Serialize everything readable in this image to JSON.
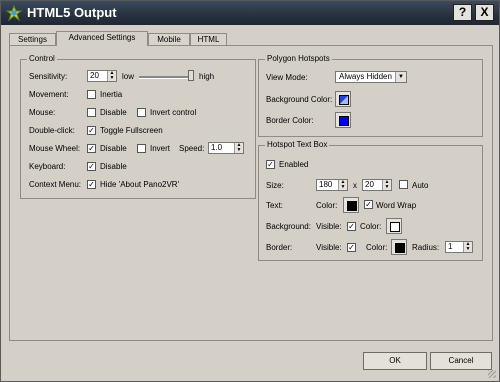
{
  "window": {
    "title": "HTML5 Output",
    "help_label": "?",
    "close_label": "X"
  },
  "tabs": [
    {
      "label": "Settings",
      "active": false
    },
    {
      "label": "Advanced Settings",
      "active": true
    },
    {
      "label": "Mobile",
      "active": false
    },
    {
      "label": "HTML",
      "active": false
    }
  ],
  "control": {
    "title": "Control",
    "sensitivity": {
      "label": "Sensitivity:",
      "value": "20",
      "low": "low",
      "high": "high",
      "slider_level": 1.0
    },
    "movement": {
      "label": "Movement:",
      "inertia_label": "Inertia",
      "inertia_checked": false
    },
    "mouse": {
      "label": "Mouse:",
      "disable_label": "Disable",
      "disable_checked": false,
      "invert_label": "Invert control",
      "invert_checked": false
    },
    "doubleclick": {
      "label": "Double-click:",
      "fullscreen_label": "Toggle Fullscreen",
      "fullscreen_checked": true
    },
    "wheel": {
      "label": "Mouse Wheel:",
      "disable_label": "Disable",
      "disable_checked": true,
      "invert_label": "Invert",
      "invert_checked": false,
      "speed_label": "Speed:",
      "speed_value": "1.0"
    },
    "keyboard": {
      "label": "Keyboard:",
      "disable_label": "Disable",
      "disable_checked": true
    },
    "context": {
      "label": "Context Menu:",
      "hide_label": "Hide 'About Pano2VR'",
      "hide_checked": true
    }
  },
  "polygon": {
    "title": "Polygon Hotspots",
    "view_mode_label": "View Mode:",
    "view_mode_value": "Always Hidden",
    "bg_label": "Background Color:",
    "bg_color": "#2244dd",
    "border_label": "Border Color:",
    "border_color": "#0000ee"
  },
  "textbox": {
    "title": "Hotspot Text Box",
    "enabled_label": "Enabled",
    "enabled_checked": true,
    "size_label": "Size:",
    "width": "180",
    "x_label": "x",
    "height": "20",
    "auto_label": "Auto",
    "auto_checked": false,
    "text_label": "Text:",
    "text_color_label": "Color:",
    "text_color": "#000000",
    "wordwrap_label": "Word Wrap",
    "wordwrap_checked": true,
    "background_label": "Background:",
    "bg_visible_label": "Visible:",
    "bg_visible_checked": true,
    "bg_color_label": "Color:",
    "bg_color": "#ffffff",
    "border_label": "Border:",
    "border_visible_label": "Visible:",
    "border_visible_checked": true,
    "border_color_label": "Color:",
    "border_color": "#000000",
    "radius_label": "Radius:",
    "radius_value": "1"
  },
  "footer": {
    "ok_label": "OK",
    "cancel_label": "Cancel"
  }
}
